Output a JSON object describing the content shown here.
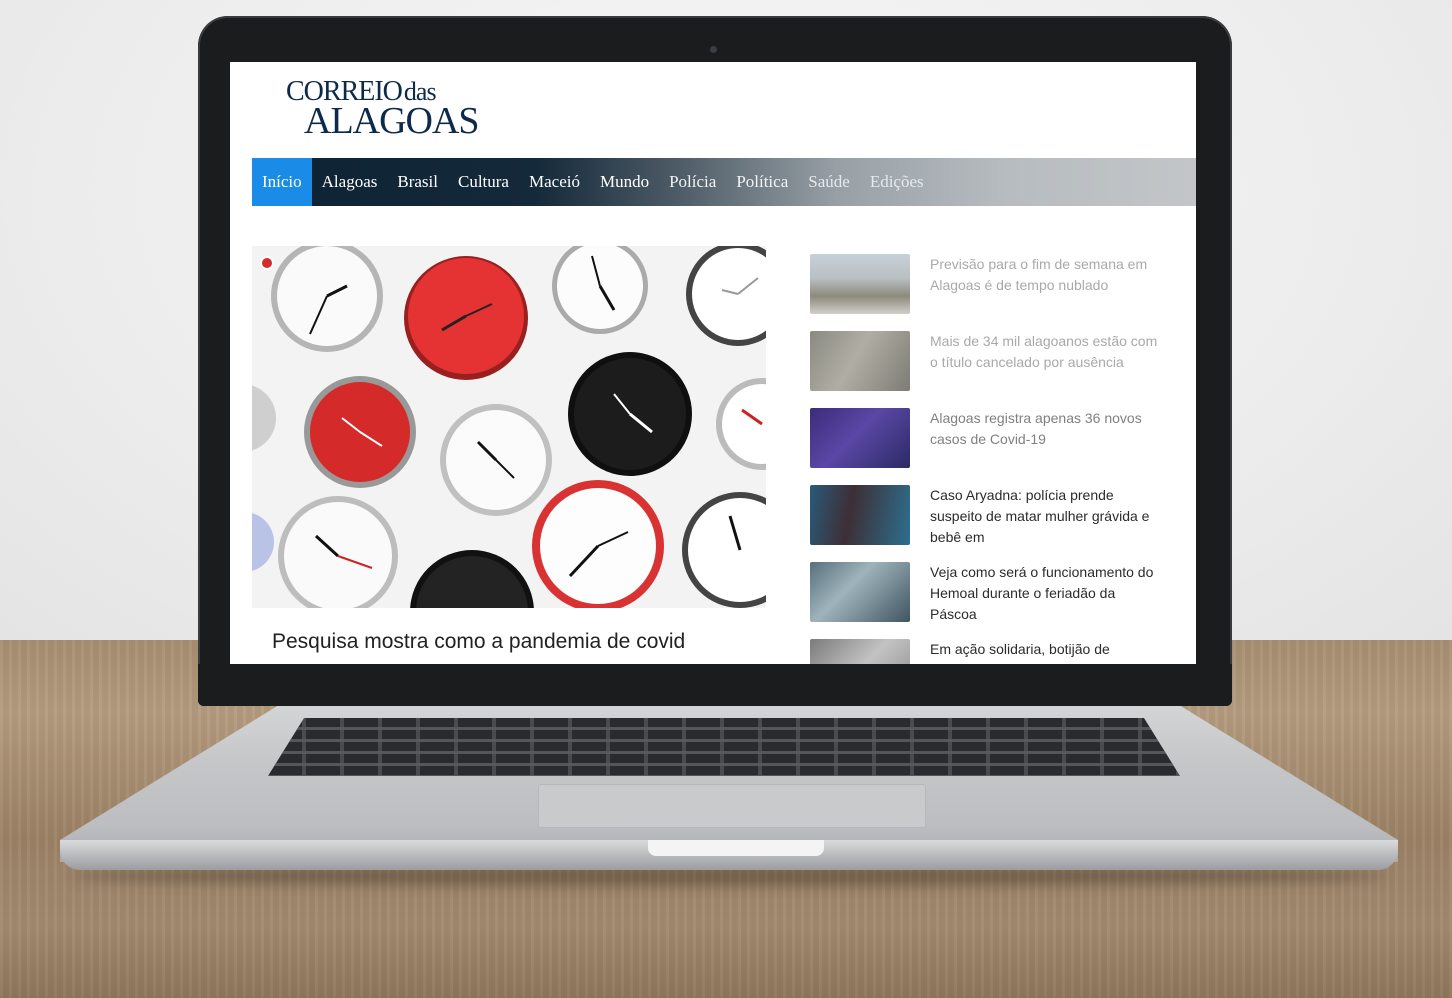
{
  "site": {
    "logo_line1": "CORREIO",
    "logo_line1_small": "das",
    "logo_line2": "ALAGOAS"
  },
  "nav": {
    "items": [
      "Início",
      "Alagoas",
      "Brasil",
      "Cultura",
      "Maceió",
      "Mundo",
      "Polícia",
      "Política",
      "Saúde",
      "Edições"
    ],
    "active_index": 0
  },
  "hero": {
    "title": "Pesquisa mostra como a pandemia de covid"
  },
  "sidebar": {
    "items": [
      {
        "text": "Previsão para o fim de semana em Alagoas é de tempo nublado"
      },
      {
        "text": "Mais de 34 mil alagoanos estão com o título cancelado por ausência"
      },
      {
        "text": "Alagoas registra apenas 36 novos casos de Covid-19"
      },
      {
        "text": "Caso Aryadna: polícia prende suspeito de matar mulher grávida e bebê em"
      },
      {
        "text": "Veja como será o funcionamento do Hemoal durante o feriadão da Páscoa"
      },
      {
        "text": "Em ação solidaria, botijão de"
      }
    ]
  },
  "colors": {
    "nav_active": "#1a8ce8",
    "nav_dark": "#0d2232",
    "logo": "#0e2a4a"
  }
}
